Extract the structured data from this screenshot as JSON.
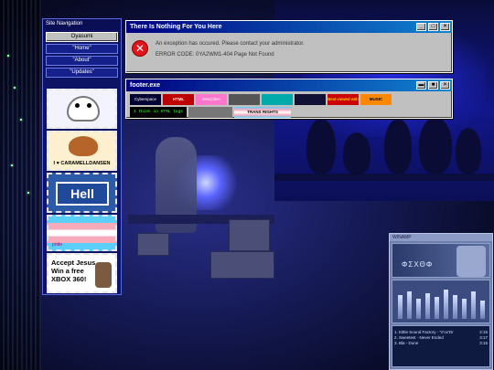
{
  "sidebar": {
    "title": "Site Navigation",
    "items": [
      {
        "label": "Oyasumi",
        "active": true
      },
      {
        "label": "\"Home\"",
        "active": false
      },
      {
        "label": "\"About\"",
        "active": false
      },
      {
        "label": "\"Updates\"",
        "active": false
      }
    ],
    "stamps": [
      {
        "name": "cute-ghost-stamp",
        "text": ""
      },
      {
        "name": "caramelldansen-stamp",
        "text": "I ♥ CARAMELLDANSEN"
      },
      {
        "name": "hell-sign-stamp",
        "text": "Hell"
      },
      {
        "name": "pride-flag-stamp",
        "text": "pride"
      },
      {
        "name": "accept-jesus-stamp",
        "text": "Accept Jesus Win a free XBOX 360!"
      }
    ]
  },
  "error_window": {
    "title": "There Is Nothing For You Here",
    "message": "An exception has occured. Please contact your administrator.",
    "error_code": "ERROR CODE: 0YA2WM1-404 Page Not Found",
    "buttons": [
      "_",
      "□",
      "×"
    ]
  },
  "footer_window": {
    "title": "footer.exe",
    "buttons": [
      "▬",
      "■",
      "✕"
    ],
    "badges_row1": [
      "Cyberspace",
      "HTML",
      "NeoCities",
      "",
      "",
      "",
      "Best viewed with",
      "MUSIC"
    ],
    "badges_row2": [
      "I think in HTML tags",
      "",
      "TRANS RIGHTS"
    ]
  },
  "winamp": {
    "title": "WINAMP",
    "display_text": "ΦΣΧΘΦ",
    "playlist": [
      {
        "title": "1. Kittie Sound Factory - 'V'ox'Dr",
        "time": "2:15"
      },
      {
        "title": "2. Sweetest - Never Ended",
        "time": "3:17"
      },
      {
        "title": "3. Bla - Dune",
        "time": "3:15"
      }
    ]
  },
  "colors": {
    "titlebar_start": "#000080",
    "titlebar_end": "#1084d0",
    "error_red": "#e0141c",
    "window_gray": "#c0c0c0"
  }
}
